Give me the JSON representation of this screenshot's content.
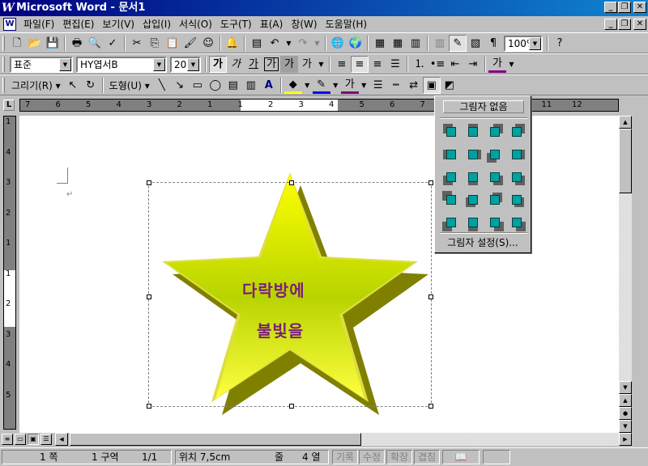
{
  "window": {
    "app_icon": "W",
    "title": "Microsoft Word - 문서1",
    "buttons": [
      "_",
      "❐",
      "✕"
    ]
  },
  "menubar": {
    "doc_icon": "W",
    "items": [
      "파일(F)",
      "편집(E)",
      "보기(V)",
      "삽입(I)",
      "서식(O)",
      "도구(T)",
      "표(A)",
      "창(W)",
      "도움말(H)"
    ],
    "doc_buttons": [
      "_",
      "❐",
      "✕"
    ]
  },
  "standard_toolbar": {
    "zoom": "100%"
  },
  "format_toolbar": {
    "style": "표준",
    "font": "HY엽서B",
    "size": "20",
    "bold": "가",
    "italic": "가",
    "underline": "가",
    "border": "가",
    "shade": "가",
    "spacing": "가",
    "font_color": "가"
  },
  "drawing_toolbar": {
    "draw_menu": "그리기(R)",
    "autoshapes_menu": "도형(U)",
    "font_color": "가"
  },
  "ruler": {
    "h_ticks": [
      "7",
      "6",
      "5",
      "4",
      "3",
      "2",
      "1",
      "1",
      "2",
      "3",
      "4",
      "5",
      "6",
      "7",
      "8",
      "9",
      "10",
      "11",
      "12"
    ],
    "v_ticks": [
      "1",
      "4",
      "3",
      "2",
      "1",
      "1",
      "2",
      "3",
      "4",
      "5"
    ]
  },
  "document": {
    "shape_text_line1": "다락방에",
    "shape_text_line2": "불빛을",
    "colors": {
      "star_front_top": "#ffff00",
      "star_front_bottom": "#8fb800",
      "star_shadow": "#808000",
      "text": "#7a1f7a"
    }
  },
  "shadow_menu": {
    "no_shadow": "그림자 없음",
    "settings": "그림자 설정(S)..."
  },
  "statusbar": {
    "page": "1 쪽",
    "section": "1 구역",
    "page_count": "1/1",
    "position": "위치 7,5cm",
    "line": "줄",
    "col": "4 열",
    "rec": "기록",
    "trk": "수정",
    "ext": "확장",
    "ovr": "겹침"
  }
}
